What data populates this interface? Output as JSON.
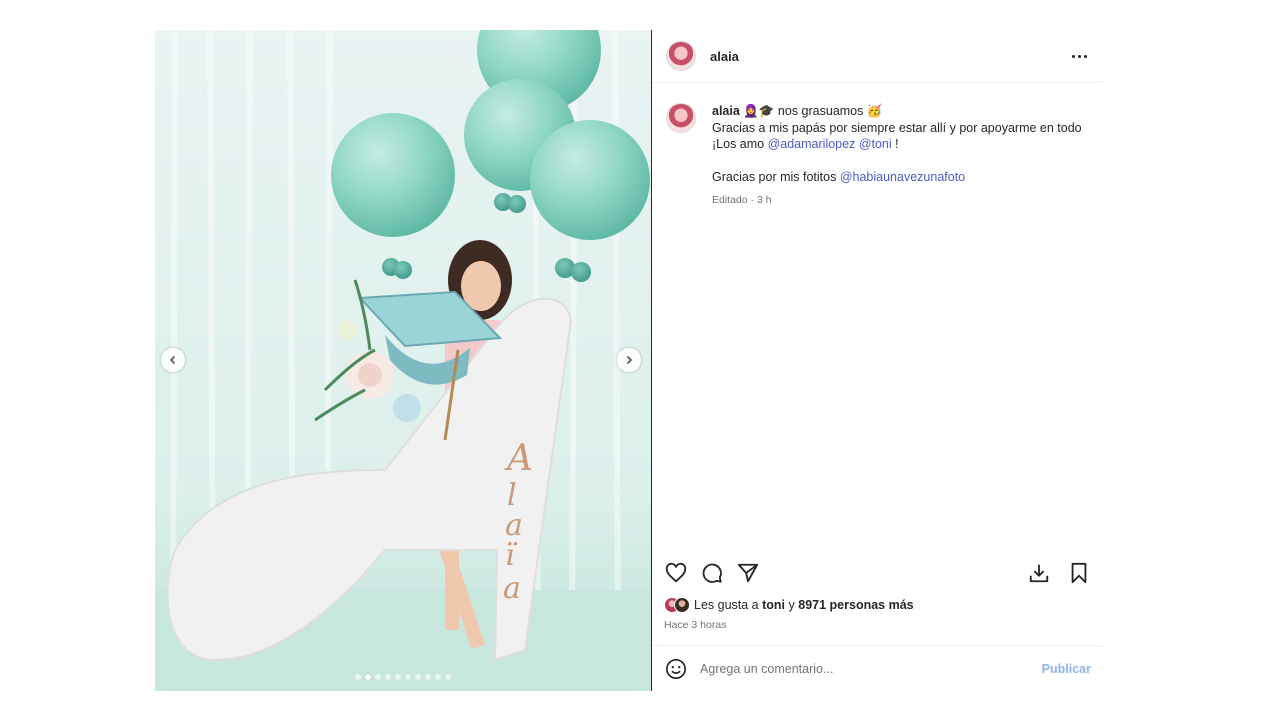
{
  "post": {
    "username": "alaia",
    "caption": {
      "username": "alaia",
      "title_emojis_left": "🧕🎓",
      "title": "nos grasuamos",
      "title_emoji_right": "🥳",
      "line2": "Gracias a mis papás por siempre estar allí y por apoyarme en todo",
      "line3_prefix": "¡Los amo",
      "mention1": "@adamarilopez",
      "mention2": "@toni",
      "line3_suffix": "!",
      "line5_prefix": "Gracias por mis fotitos",
      "mention3": "@habiaunavezunafoto",
      "edited": "Editado · 3 h"
    },
    "likes": {
      "prefix": "Les gusta a",
      "user": "toni",
      "joiner": "y",
      "others": "8971 personas más"
    },
    "time_ago": "Hace 3 horas",
    "comment": {
      "placeholder": "Agrega un comentario...",
      "publish_label": "Publicar"
    },
    "carousel": {
      "total": 10,
      "active_index": 1
    }
  },
  "photo": {
    "letter_text": "Alaïa"
  },
  "colors": {
    "mention": "#4a5cc9",
    "publish": "#8fb3ef",
    "balloon": "#8fd6c4"
  }
}
